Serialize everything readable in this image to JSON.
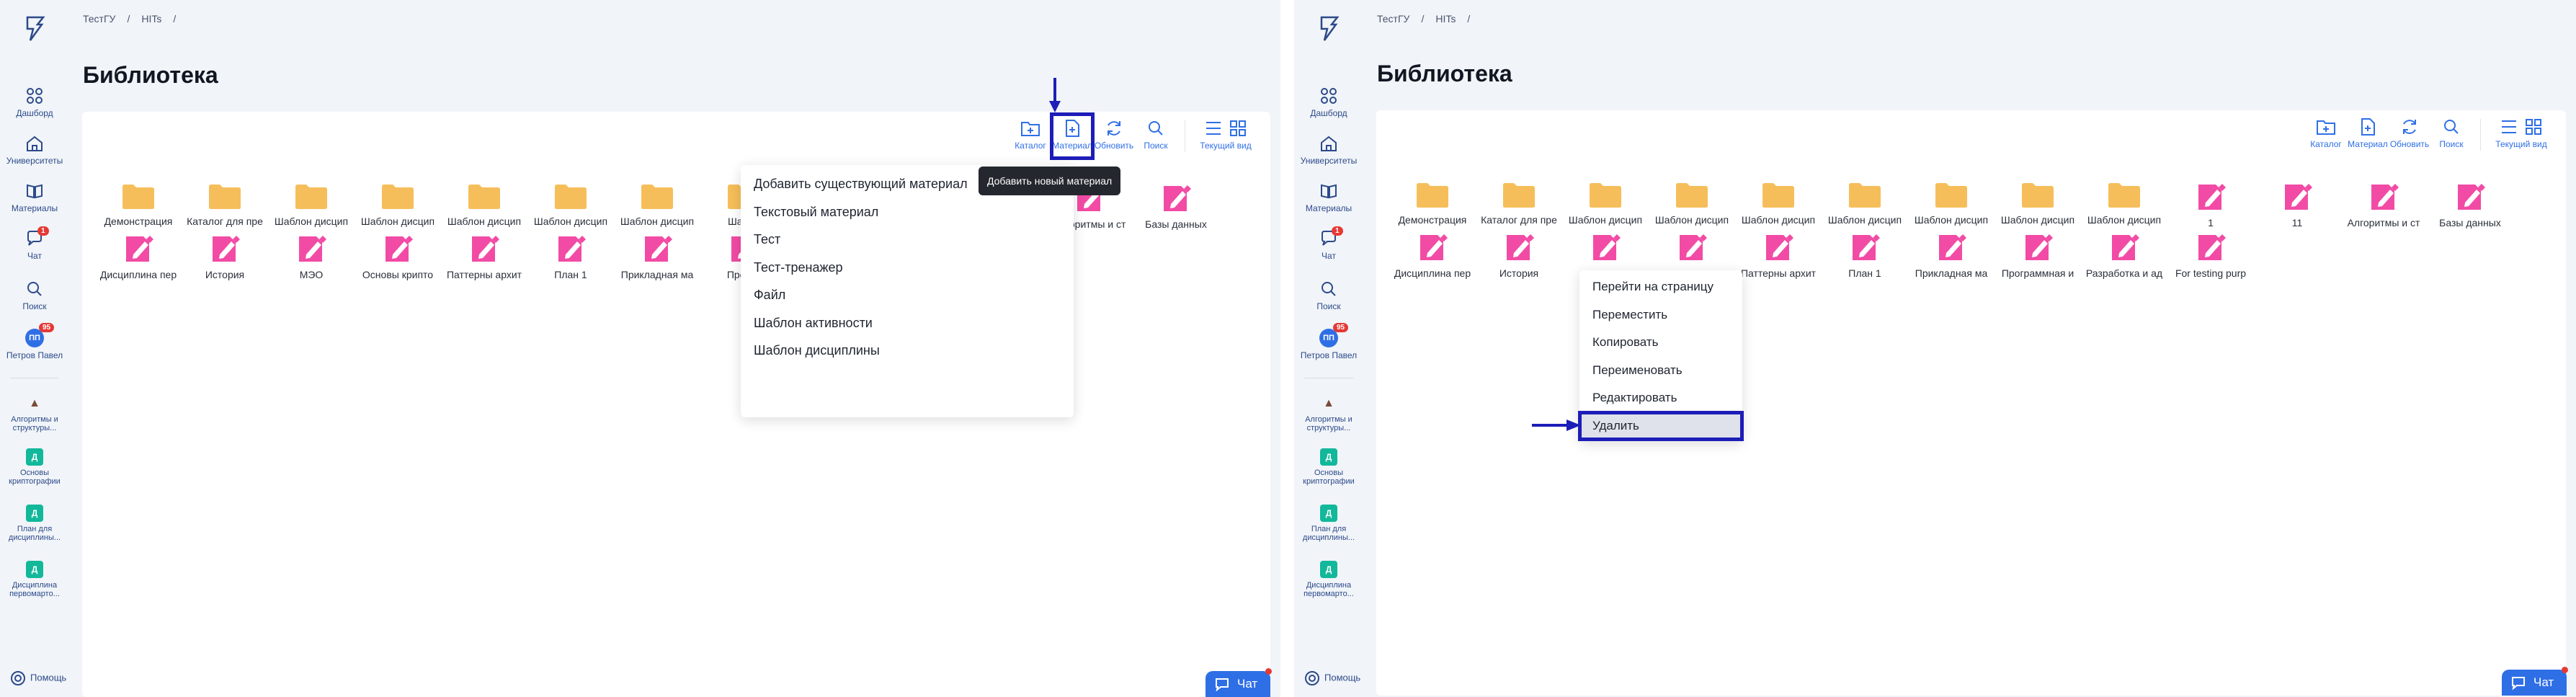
{
  "breadcrumb": [
    "ТестГУ",
    "HITs",
    "/"
  ],
  "page_title": "Библиотека",
  "sidebar": {
    "items": [
      {
        "label": "Дашборд",
        "icon": "dashboard-icon"
      },
      {
        "label": "Университеты",
        "icon": "university-icon"
      },
      {
        "label": "Материалы",
        "icon": "book-icon"
      },
      {
        "label": "Чат",
        "icon": "chat-icon",
        "badge": "1"
      },
      {
        "label": "Поиск",
        "icon": "search-icon"
      },
      {
        "label": "Петров Павел",
        "avatar": "ПП",
        "badge": "95"
      }
    ],
    "courses": [
      {
        "label": "Алгоритмы и структуры...",
        "icon": "hat"
      },
      {
        "label": "Основы криптографии",
        "icon": "Д"
      },
      {
        "label": "План для дисциплины...",
        "icon": "Д"
      },
      {
        "label": "Дисциплина первомарто...",
        "icon": "Д"
      }
    ],
    "help": "Помощь"
  },
  "toolbar": {
    "catalog": "Каталог",
    "material": "Материал",
    "refresh": "Обновить",
    "search": "Поиск",
    "view": "Текущий вид"
  },
  "left": {
    "row1": [
      "Демонстрация",
      "Каталог для пре",
      "Шаблон дисцип",
      "Шаблон дисцип",
      "Шаблон дисцип",
      "Шаблон дисцип",
      "Шаблон дисцип",
      "Шабло",
      "",
      "",
      "",
      "Алгоритмы и ст",
      "Базы данных"
    ],
    "row2": [
      "Дисциплина пер",
      "История",
      "МЭО",
      "Основы крипто",
      "Паттерны архит",
      "План 1",
      "Прикладная ма",
      "Програ"
    ],
    "dropdown": [
      "Добавить существующий материал",
      "Текстовый материал",
      "Тест",
      "Тест-тренажер",
      "Файл",
      "Шаблон активности",
      "Шаблон дисциплины"
    ],
    "tooltip": "Добавить новый материал"
  },
  "right": {
    "row1": [
      "Демонстрация",
      "Каталог для пре",
      "Шаблон дисцип",
      "Шаблон дисцип",
      "Шаблон дисцип",
      "Шаблон дисцип",
      "Шаблон дисцип",
      "Шаблон дисцип",
      "Шаблон дисцип",
      "1",
      "11",
      "Алгоритмы и ст",
      "Базы данных"
    ],
    "row2": [
      "Дисциплина пер",
      "История",
      "",
      "",
      "Паттерны архит",
      "План 1",
      "Прикладная ма",
      "Программная и",
      "Разработка и ад",
      "For testing purp"
    ],
    "context_menu": [
      "Перейти на страницу",
      "Переместить",
      "Копировать",
      "Переименовать",
      "Редактировать",
      "Удалить"
    ]
  },
  "chat_button": "Чат",
  "colors": {
    "accent": "#2f6fe6",
    "highlight": "#1d1db8",
    "folder": "#f6be5a",
    "material": "#f24ba5",
    "badge": "#e53935",
    "course": "#12b89a"
  }
}
